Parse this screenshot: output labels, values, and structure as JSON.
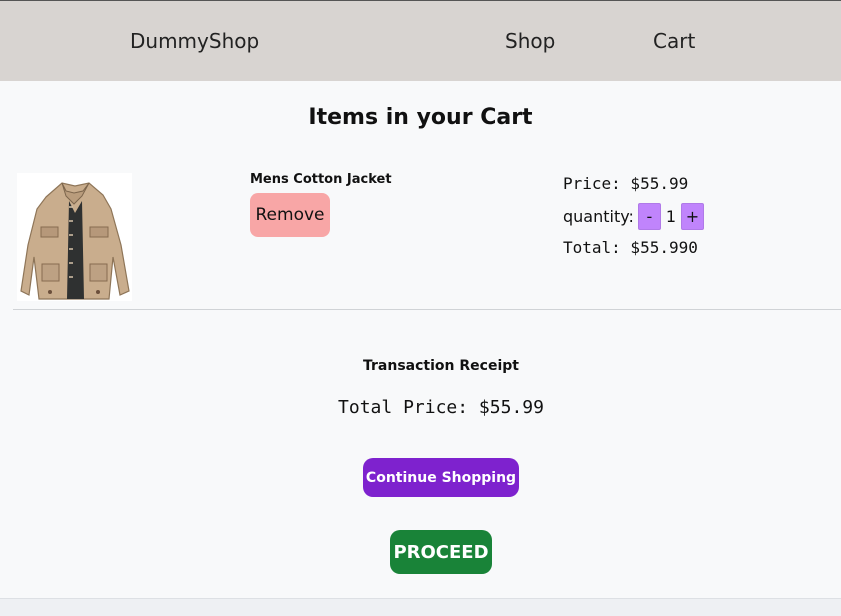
{
  "nav": {
    "brand": "DummyShop",
    "links": [
      "Shop",
      "Cart"
    ]
  },
  "cart": {
    "title": "Items in your Cart",
    "items": [
      {
        "name": "Mens Cotton Jacket",
        "remove_label": "Remove",
        "price_text": "Price: $55.99",
        "quantity_label": "quantity:",
        "decrement_label": "-",
        "quantity": "1",
        "increment_label": "+",
        "total_text": "Total: $55.990",
        "image_icon": "jacket-image"
      }
    ]
  },
  "receipt": {
    "title": "Transaction Receipt",
    "total_text": "Total Price: $55.99",
    "continue_label": "Continue Shopping",
    "proceed_label": "PROCEED"
  },
  "colors": {
    "navbar": "#d8d4d1",
    "remove_button": "#f8a6a6",
    "quantity_button": "#c084fc",
    "continue_button": "#7e22ce",
    "proceed_button": "#198338"
  }
}
